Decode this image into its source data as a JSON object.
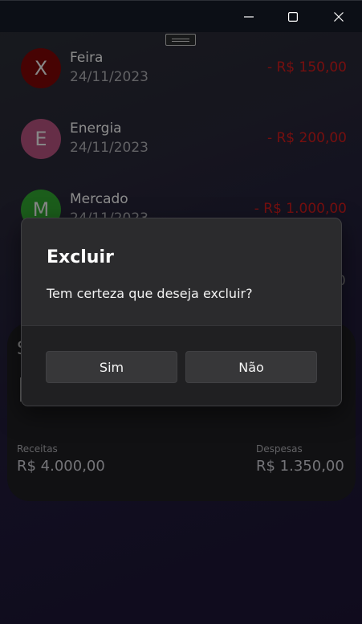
{
  "transactions": [
    {
      "initial": "X",
      "name": "Feira",
      "date": "24/11/2023",
      "amount": "- R$ 150,00",
      "color": "#7a0606"
    },
    {
      "initial": "E",
      "name": "Energia",
      "date": "24/11/2023",
      "amount": "- R$ 200,00",
      "color": "#b0507a"
    },
    {
      "initial": "M",
      "name": "Mercado",
      "date": "24/11/2023",
      "amount": "- R$ 1.000,00",
      "color": "#2fa02f"
    }
  ],
  "summary": {
    "peek_title": "S",
    "income_label": "Receitas",
    "income_value": "R$ 4.000,00",
    "expense_label": "Despesas",
    "expense_value": "R$ 1.350,00"
  },
  "stray_text": "0",
  "dialog": {
    "title": "Excluir",
    "message": "Tem certeza que deseja excluir?",
    "confirm_label": "Sim",
    "cancel_label": "Não"
  },
  "colors": {
    "expense": "#cc1a1a",
    "dialog_bg": "#2b2b2d",
    "titlebar_bg": "#0c0f16"
  }
}
